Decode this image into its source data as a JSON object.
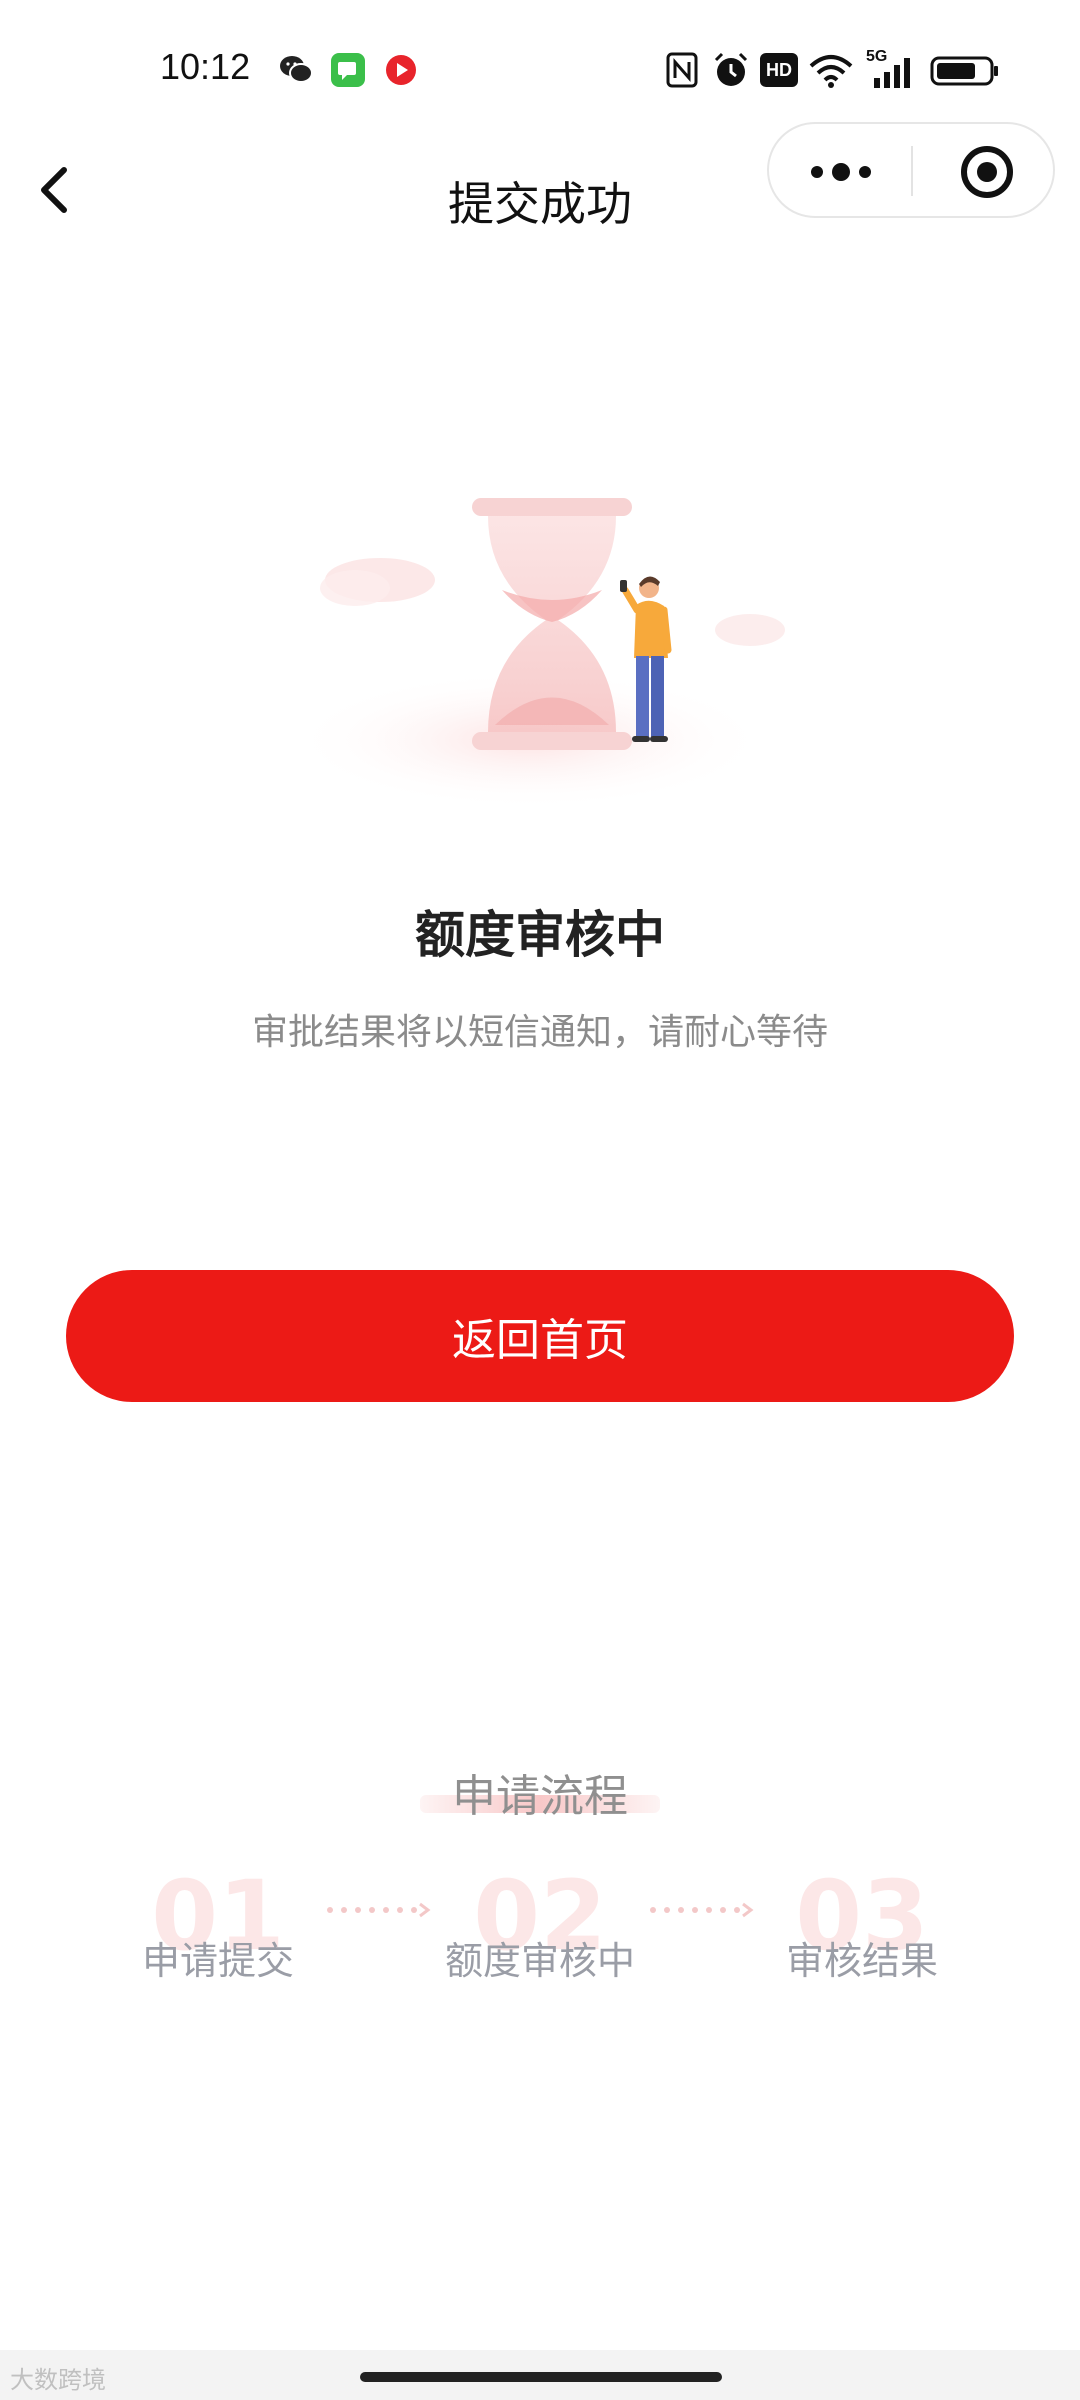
{
  "status_bar": {
    "time": "10:12",
    "icons": [
      "wechat-icon",
      "messages-icon",
      "video-icon",
      "nfc-icon",
      "alarm-icon",
      "hd-icon",
      "wifi-icon",
      "signal-5g-icon",
      "battery-icon"
    ],
    "hd_text": "HD",
    "net_text": "5G"
  },
  "nav": {
    "title": "提交成功",
    "back_icon": "chevron-left-icon",
    "more_icon": "more-icon",
    "close_icon": "target-icon"
  },
  "status": {
    "title": "额度审核中",
    "description": "审批结果将以短信通知，请耐心等待"
  },
  "actions": {
    "home_button": "返回首页"
  },
  "process": {
    "title": "申请流程",
    "steps": [
      {
        "num": "01",
        "label": "申请提交"
      },
      {
        "num": "02",
        "label": "额度审核中"
      },
      {
        "num": "03",
        "label": "审核结果"
      }
    ]
  },
  "footer": {
    "watermark": "大数跨境"
  },
  "colors": {
    "primary": "#ec1a16",
    "text": "#222222",
    "muted": "#8b8b8b"
  }
}
